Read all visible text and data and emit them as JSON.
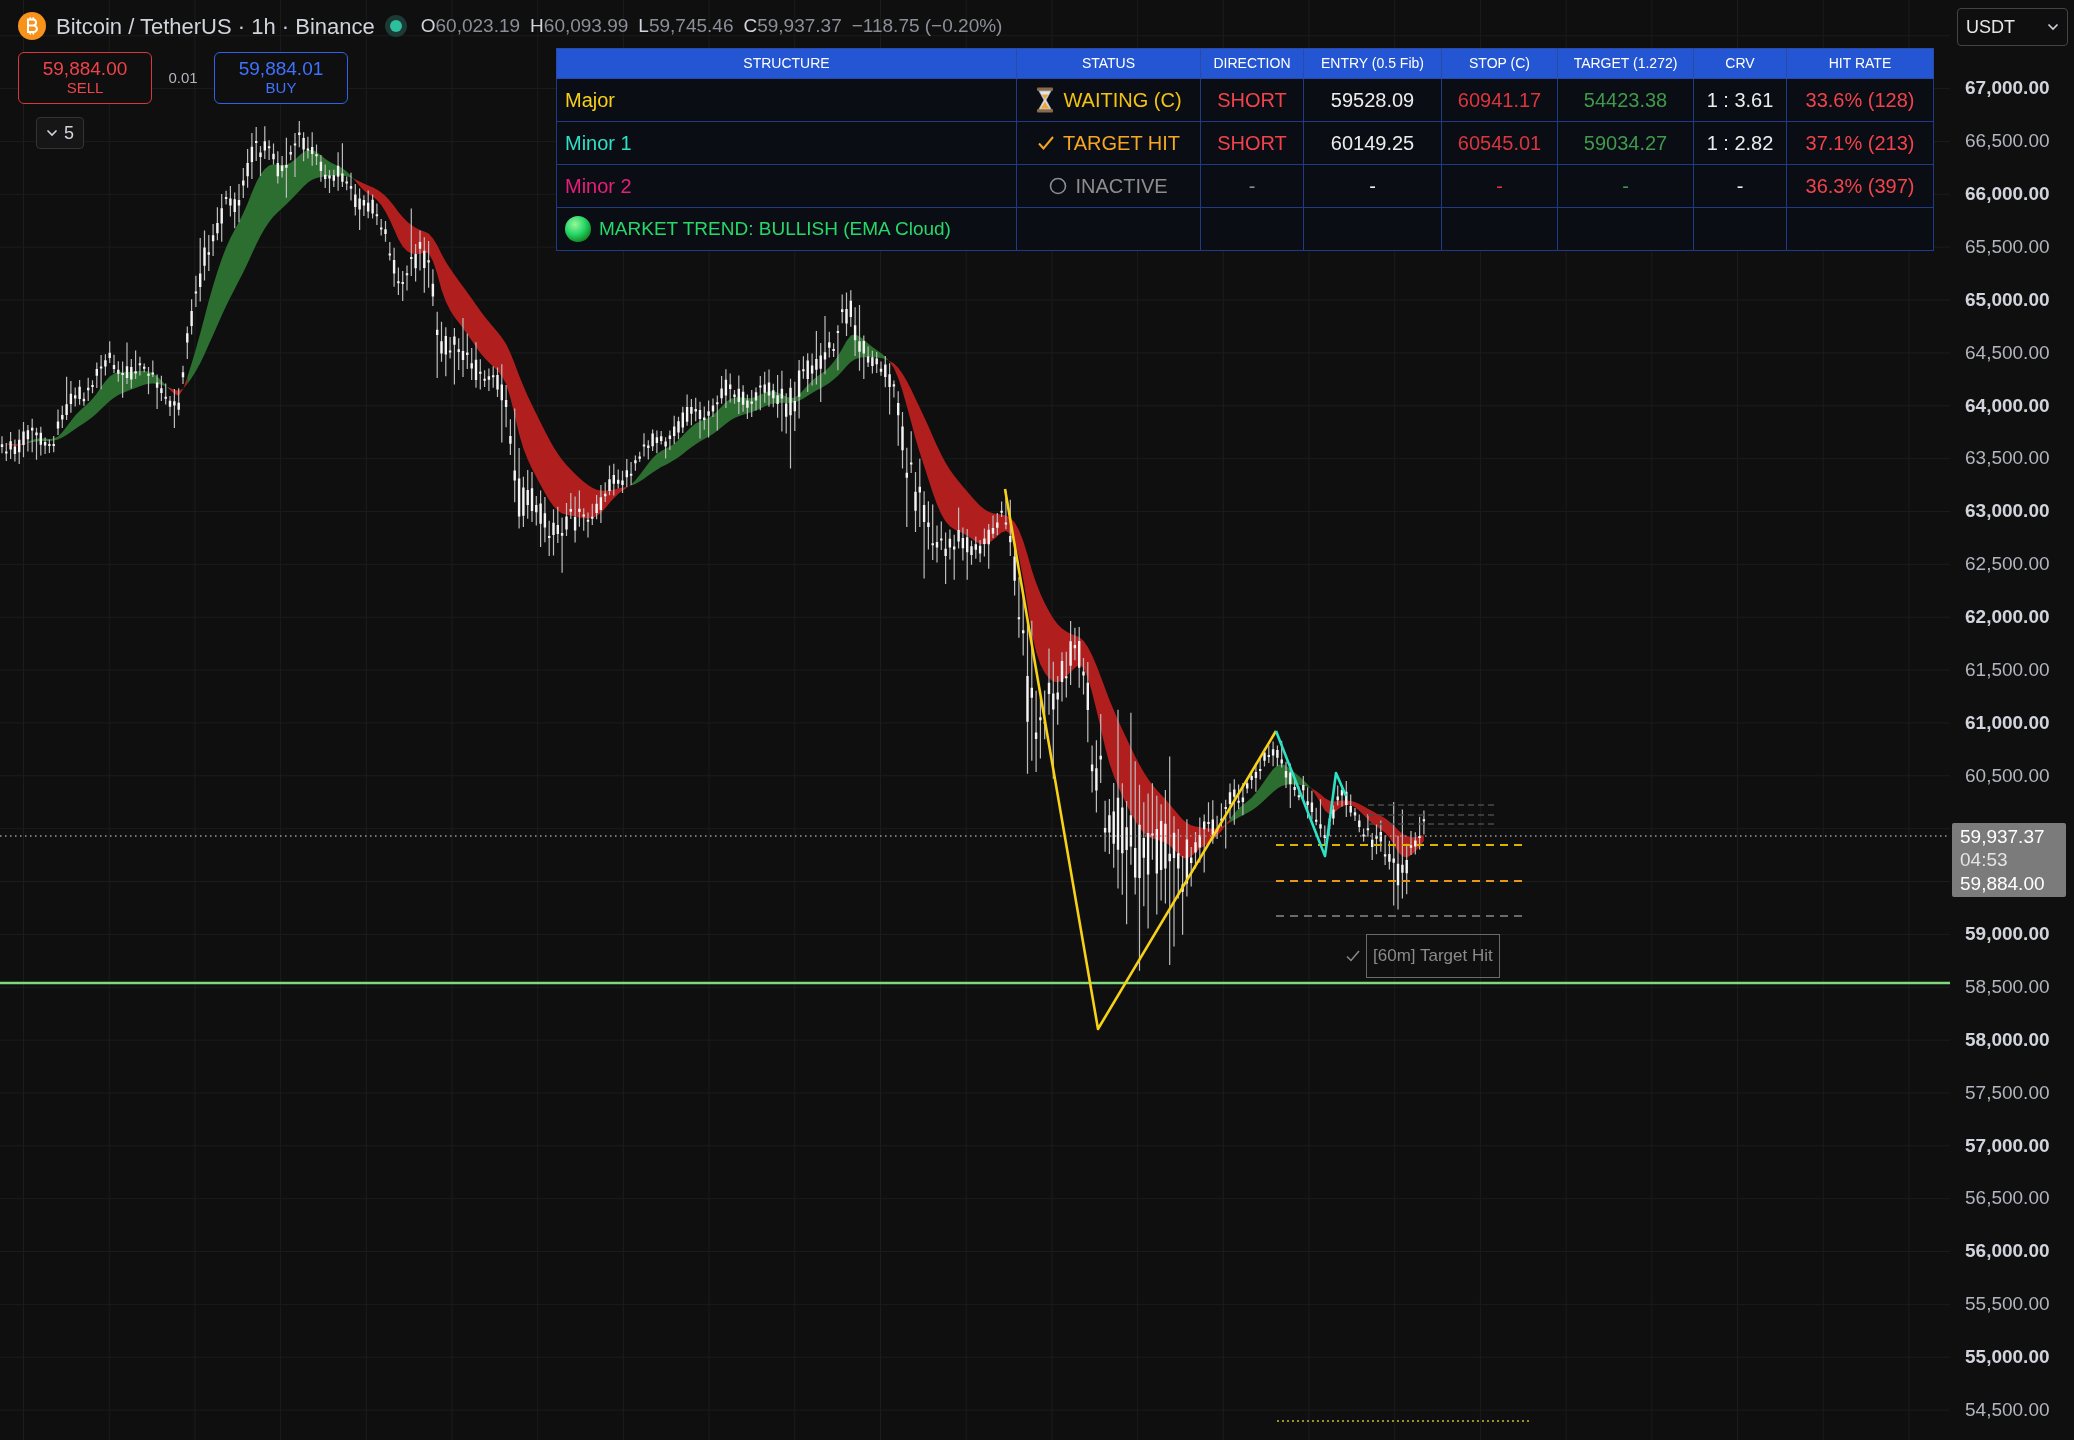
{
  "header": {
    "symbol": "Bitcoin / TetherUS · 1h · Binance",
    "ohlc": [
      {
        "label": "O",
        "value": "60,023.19"
      },
      {
        "label": "H",
        "value": "60,093.99"
      },
      {
        "label": "L",
        "value": "59,745.46"
      },
      {
        "label": "C",
        "value": "59,937.37"
      }
    ],
    "change": "−118.75 (−0.20%)"
  },
  "trade": {
    "sell": {
      "price": "59,884.00",
      "label": "SELL"
    },
    "spread": "0.01",
    "buy": {
      "price": "59,884.01",
      "label": "BUY"
    }
  },
  "layers_button": {
    "count": "5"
  },
  "signal_table": {
    "columns": [
      "STRUCTURE",
      "STATUS",
      "DIRECTION",
      "ENTRY (0.5 Fib)",
      "STOP (C)",
      "TARGET (1.272)",
      "CRV",
      "HIT RATE"
    ],
    "rows": [
      {
        "name": "Major",
        "color": "#f7d117",
        "status": {
          "kind": "waiting",
          "text": "WAITING (C)"
        },
        "direction": {
          "kind": "short",
          "text": "SHORT"
        },
        "entry": "59528.09",
        "stop": "60941.17",
        "target": "54423.38",
        "crv": "1 : 3.61",
        "hit_rate": "33.6% (128)"
      },
      {
        "name": "Minor 1",
        "color": "#2ee0c4",
        "status": {
          "kind": "target_hit",
          "text": "TARGET HIT"
        },
        "direction": {
          "kind": "short",
          "text": "SHORT"
        },
        "entry": "60149.25",
        "stop": "60545.01",
        "target": "59034.27",
        "crv": "1 : 2.82",
        "hit_rate": "37.1% (213)"
      },
      {
        "name": "Minor 2",
        "color": "#e91e7b",
        "status": {
          "kind": "inactive",
          "text": "INACTIVE"
        },
        "direction": {
          "kind": "none",
          "text": "-"
        },
        "entry": "-",
        "stop": "-",
        "target": "-",
        "crv": "-",
        "hit_rate": "36.3% (397)"
      }
    ],
    "trend": {
      "kind": "bullish",
      "text": "MARKET TREND: BULLISH (EMA Cloud)"
    }
  },
  "chart": {
    "annotation": "[60m] Target Hit"
  },
  "price_axis": {
    "currency": "USDT",
    "items": [
      {
        "kind": "major",
        "text": "67,000.00"
      },
      {
        "kind": "minor",
        "text": "66,500.00"
      },
      {
        "kind": "major",
        "text": "66,000.00"
      },
      {
        "kind": "minor",
        "text": "65,500.00"
      },
      {
        "kind": "major",
        "text": "65,000.00"
      },
      {
        "kind": "minor",
        "text": "64,500.00"
      },
      {
        "kind": "major",
        "text": "64,000.00"
      },
      {
        "kind": "minor",
        "text": "63,500.00"
      },
      {
        "kind": "major",
        "text": "63,000.00"
      },
      {
        "kind": "minor",
        "text": "62,500.00"
      },
      {
        "kind": "major",
        "text": "62,000.00"
      },
      {
        "kind": "minor",
        "text": "61,500.00"
      },
      {
        "kind": "major",
        "text": "61,000.00"
      },
      {
        "kind": "minor",
        "text": "60,500.00"
      },
      {
        "kind": "marker",
        "last_price": "59,937.37",
        "countdown": "04:53",
        "bid_price": "59,884.00"
      },
      {
        "kind": "major",
        "text": "59,000.00"
      },
      {
        "kind": "minor",
        "text": "58,500.00"
      },
      {
        "kind": "major",
        "text": "58,000.00"
      },
      {
        "kind": "minor",
        "text": "57,500.00"
      },
      {
        "kind": "major",
        "text": "57,000.00"
      },
      {
        "kind": "minor",
        "text": "56,500.00"
      },
      {
        "kind": "major",
        "text": "56,000.00"
      },
      {
        "kind": "minor",
        "text": "55,500.00"
      },
      {
        "kind": "major",
        "text": "55,000.00"
      },
      {
        "kind": "minor",
        "text": "54,500.00"
      }
    ]
  }
}
